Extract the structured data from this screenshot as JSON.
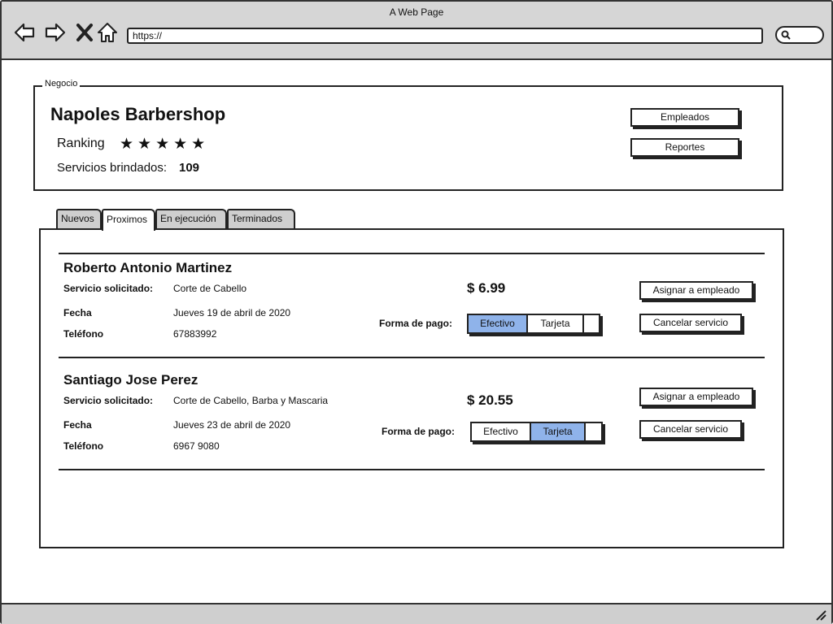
{
  "browser": {
    "title": "A Web Page",
    "url": "https://"
  },
  "business": {
    "legend": "Negocio",
    "name": "Napoles Barbershop",
    "ranking_label": "Ranking",
    "stars": 5,
    "stars_text": "★★★★★",
    "services_label": "Servicios brindados:",
    "services_count": "109",
    "employees_button": "Empleados",
    "reports_button": "Reportes"
  },
  "tabs": [
    {
      "label": "Nuevos",
      "active": false
    },
    {
      "label": "Proximos",
      "active": true
    },
    {
      "label": "En ejecución",
      "active": false
    },
    {
      "label": "Terminados",
      "active": false
    }
  ],
  "labels": {
    "service": "Servicio solicitado:",
    "date": "Fecha",
    "phone": "Teléfono",
    "payment": "Forma de pago:",
    "assign_button": "Asignar a empleado",
    "cancel_button": "Cancelar servicio",
    "cash": "Efectivo",
    "card": "Tarjeta"
  },
  "orders": [
    {
      "customer": "Roberto Antonio Martinez",
      "service": "Corte de Cabello",
      "date": "Jueves 19 de abril de 2020",
      "phone": "67883992",
      "price": "$ 6.99",
      "payment_selected": "Efectivo"
    },
    {
      "customer": "Santiago Jose Perez",
      "service": "Corte de Cabello, Barba y Mascaria",
      "date": "Jueves 23 de abril de 2020",
      "phone": "6967 9080",
      "price": "$ 20.55",
      "payment_selected": "Tarjeta"
    }
  ],
  "colors": {
    "selected_segment": "#8fb3ea",
    "chrome": "#d6d6d6"
  }
}
